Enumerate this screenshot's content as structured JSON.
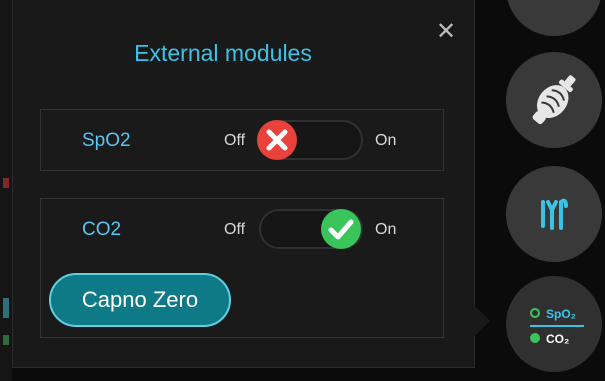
{
  "popup": {
    "title": "External modules",
    "close_icon": "close-icon",
    "modules": [
      {
        "name": "SpO2",
        "off_label": "Off",
        "on_label": "On",
        "enabled": false
      },
      {
        "name": "CO2",
        "off_label": "Off",
        "on_label": "On",
        "enabled": true
      }
    ],
    "capno_button_label": "Capno Zero"
  },
  "sidebar": {
    "modules_button": {
      "line1": "SpO₂",
      "line2": "CO₂"
    }
  },
  "colors": {
    "accent": "#3bc3e6",
    "off_red": "#e9413c",
    "on_green": "#39c55a",
    "button_teal": "#0f7a87"
  }
}
